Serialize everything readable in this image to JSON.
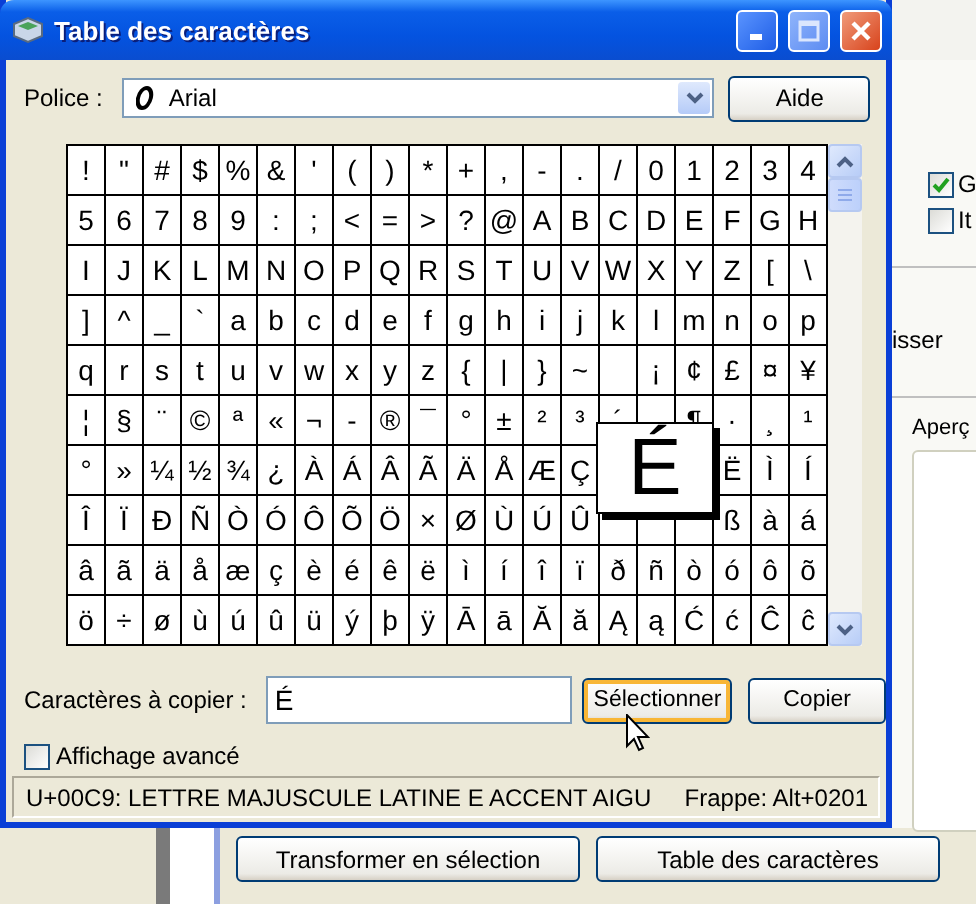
{
  "window": {
    "title": "Table des caractères"
  },
  "font": {
    "label": "Police :",
    "value": "Arial"
  },
  "help_button": "Aide",
  "grid": {
    "rows": [
      [
        "!",
        "\"",
        "#",
        "$",
        "%",
        "&",
        "'",
        "(",
        ")",
        "*",
        "+",
        ",",
        "-",
        ".",
        "/",
        "0",
        "1",
        "2",
        "3",
        "4"
      ],
      [
        "5",
        "6",
        "7",
        "8",
        "9",
        ":",
        ";",
        "<",
        "=",
        ">",
        "?",
        "@",
        "A",
        "B",
        "C",
        "D",
        "E",
        "F",
        "G",
        "H"
      ],
      [
        "I",
        "J",
        "K",
        "L",
        "M",
        "N",
        "O",
        "P",
        "Q",
        "R",
        "S",
        "T",
        "U",
        "V",
        "W",
        "X",
        "Y",
        "Z",
        "[",
        "\\"
      ],
      [
        "]",
        "^",
        "_",
        "`",
        "a",
        "b",
        "c",
        "d",
        "e",
        "f",
        "g",
        "h",
        "i",
        "j",
        "k",
        "l",
        "m",
        "n",
        "o",
        "p"
      ],
      [
        "q",
        "r",
        "s",
        "t",
        "u",
        "v",
        "w",
        "x",
        "y",
        "z",
        "{",
        "|",
        "}",
        "~",
        null,
        "¡",
        "¢",
        "£",
        "¤",
        "¥"
      ],
      [
        "¦",
        "§",
        "¨",
        "©",
        "ª",
        "«",
        "¬",
        "-",
        "®",
        "¯",
        "°",
        "±",
        "²",
        "³",
        "´",
        null,
        "¶",
        "·",
        "¸",
        "¹"
      ],
      [
        "°",
        "»",
        "¼",
        "½",
        "¾",
        "¿",
        "À",
        "Á",
        "Â",
        "Ã",
        "Ä",
        "Å",
        "Æ",
        "Ç",
        null,
        null,
        null,
        "Ë",
        "Ì",
        "Í"
      ],
      [
        "Î",
        "Ï",
        "Ð",
        "Ñ",
        "Ò",
        "Ó",
        "Ô",
        "Õ",
        "Ö",
        "×",
        "Ø",
        "Ù",
        "Ú",
        "Û",
        null,
        null,
        null,
        "ß",
        "à",
        "á"
      ],
      [
        "â",
        "ã",
        "ä",
        "å",
        "æ",
        "ç",
        "è",
        "é",
        "ê",
        "ë",
        "ì",
        "í",
        "î",
        "ï",
        "ð",
        "ñ",
        "ò",
        "ó",
        "ô",
        "õ"
      ],
      [
        "ö",
        "÷",
        "ø",
        "ù",
        "ú",
        "û",
        "ü",
        "ý",
        "þ",
        "ÿ",
        "Ā",
        "ā",
        "Ă",
        "ă",
        "Ą",
        "ą",
        "Ć",
        "ć",
        "Ĉ",
        "ĉ"
      ]
    ]
  },
  "magnified": {
    "char": "É"
  },
  "copy": {
    "label": "Caractères à copier :",
    "value": "É"
  },
  "buttons": [
    {
      "label": "Sélectionner",
      "hovered": true
    },
    {
      "label": "Copier",
      "hovered": false
    }
  ],
  "advanced": {
    "label": "Affichage avancé",
    "checked": false
  },
  "status_bar": {
    "description": "U+00C9: LETTRE MAJUSCULE LATINE E ACCENT AIGU",
    "keystroke": "Frappe: Alt+0201"
  },
  "background_window": {
    "checkboxes": [
      {
        "label": "G",
        "checked": true
      },
      {
        "label": "It",
        "checked": false
      }
    ],
    "cut_text": "isser",
    "preview_label": "Aperç",
    "buttons": [
      "Transformer en sélection",
      "Table des caractères"
    ]
  }
}
